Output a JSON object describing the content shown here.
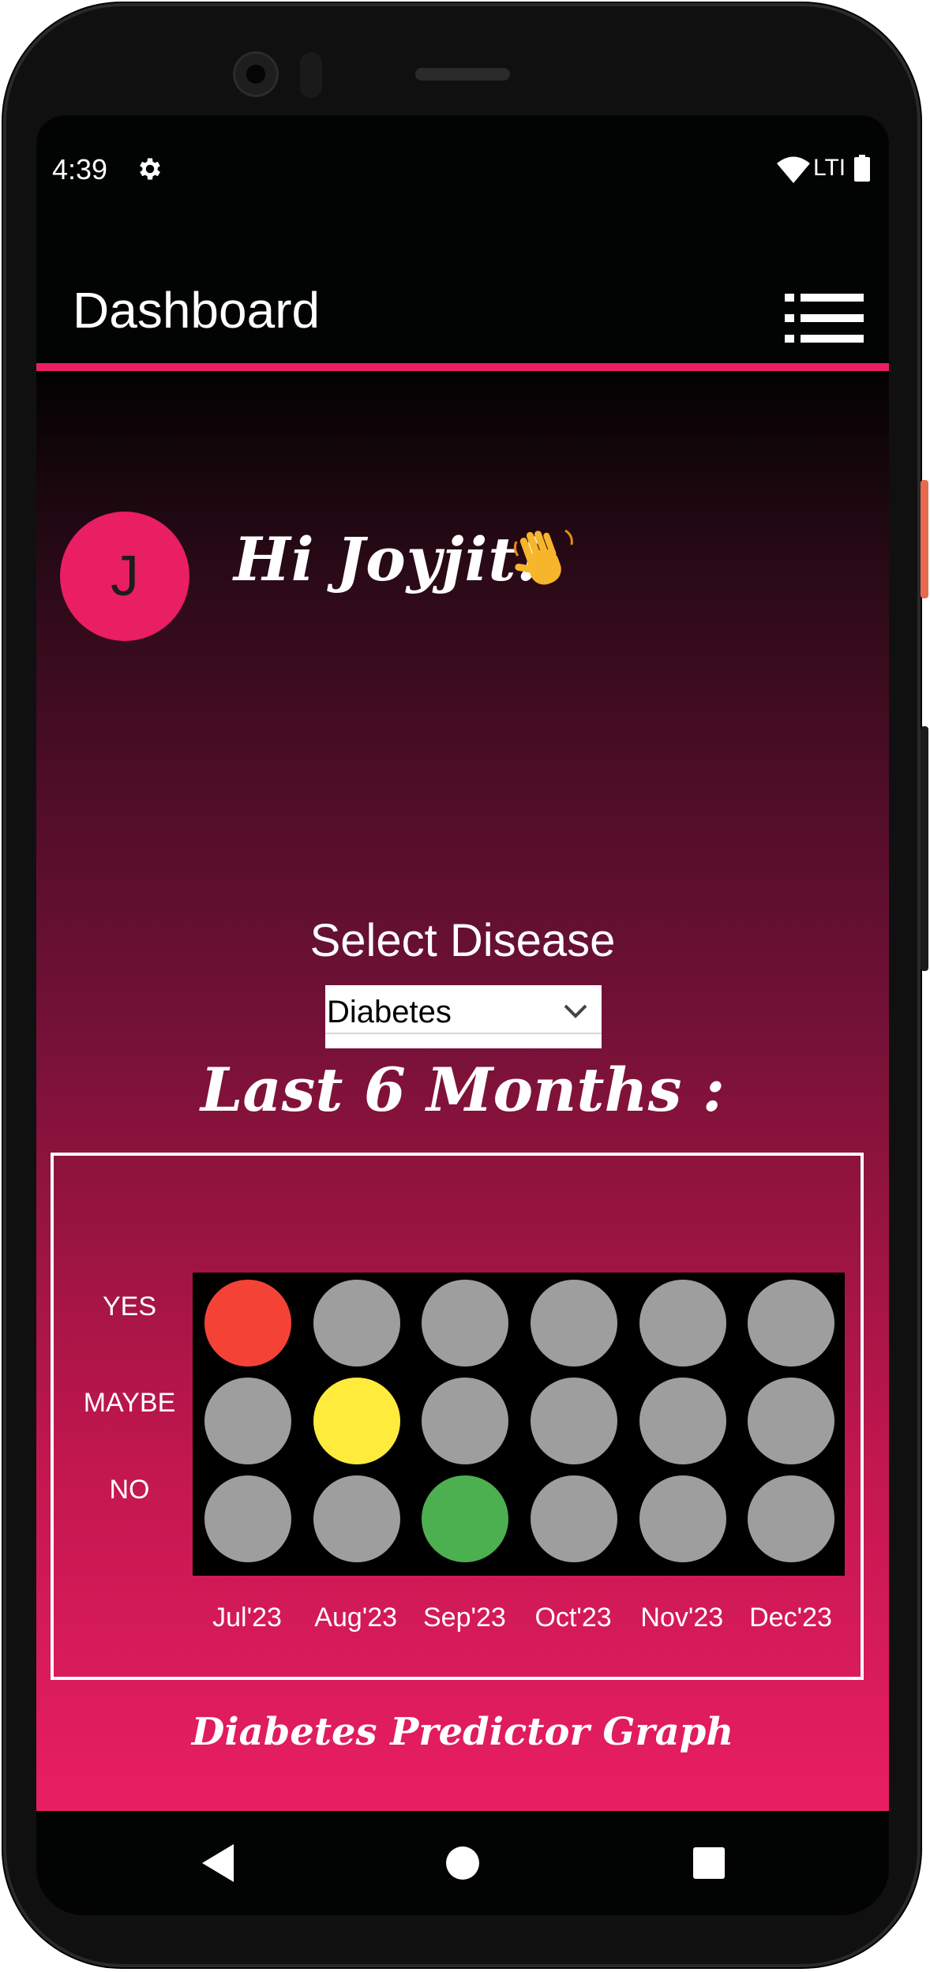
{
  "status_bar": {
    "time": "4:39",
    "network": "LTI",
    "icons": [
      "gear-icon",
      "wifi-icon",
      "battery-icon"
    ]
  },
  "app_bar": {
    "title": "Dashboard",
    "menu_icon": "list-menu-icon",
    "accent_color": "#e91e63"
  },
  "user": {
    "avatar_initial": "J",
    "greeting": "Hi Joyjit!",
    "greeting_icon": "waving-hand-icon"
  },
  "disease_select": {
    "label": "Select Disease",
    "selected": "Diabetes"
  },
  "chart_section": {
    "title": "Last 6 Months :",
    "caption": "Diabetes Predictor Graph"
  },
  "chart_data": {
    "type": "heatmap",
    "rows": [
      "YES",
      "MAYBE",
      "NO"
    ],
    "columns": [
      "Jul'23",
      "Aug'23",
      "Sep'23",
      "Oct'23",
      "Nov'23",
      "Dec'23"
    ],
    "values": [
      {
        "month": "Jul'23",
        "prediction": "YES"
      },
      {
        "month": "Aug'23",
        "prediction": "MAYBE"
      },
      {
        "month": "Sep'23",
        "prediction": "NO"
      },
      {
        "month": "Oct'23",
        "prediction": null
      },
      {
        "month": "Nov'23",
        "prediction": null
      },
      {
        "month": "Dec'23",
        "prediction": null
      }
    ],
    "colors": {
      "YES": "#f44336",
      "MAYBE": "#ffeb3b",
      "NO": "#4caf50",
      "inactive": "#9e9e9e"
    }
  },
  "nav_bar": {
    "icons": [
      "back-icon",
      "home-icon",
      "recents-icon"
    ]
  }
}
